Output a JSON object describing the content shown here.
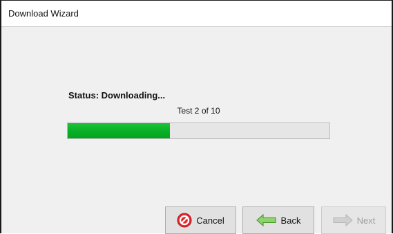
{
  "window": {
    "title": "Download Wizard"
  },
  "status": {
    "text": "Status: Downloading...",
    "progress_caption": "Test 2 of 10",
    "progress_fraction": 0.39
  },
  "buttons": {
    "cancel": {
      "label": "Cancel",
      "icon": "cancel-icon",
      "enabled": true
    },
    "back": {
      "label": "Back",
      "icon": "arrow-left-icon",
      "enabled": true
    },
    "next": {
      "label": "Next",
      "icon": "arrow-right-icon",
      "enabled": false
    }
  },
  "colors": {
    "progress_fill": "#06b025",
    "progress_track": "#e6e6e6",
    "cancel_red": "#e3262b",
    "back_arrow_green": "#8fd16a"
  }
}
